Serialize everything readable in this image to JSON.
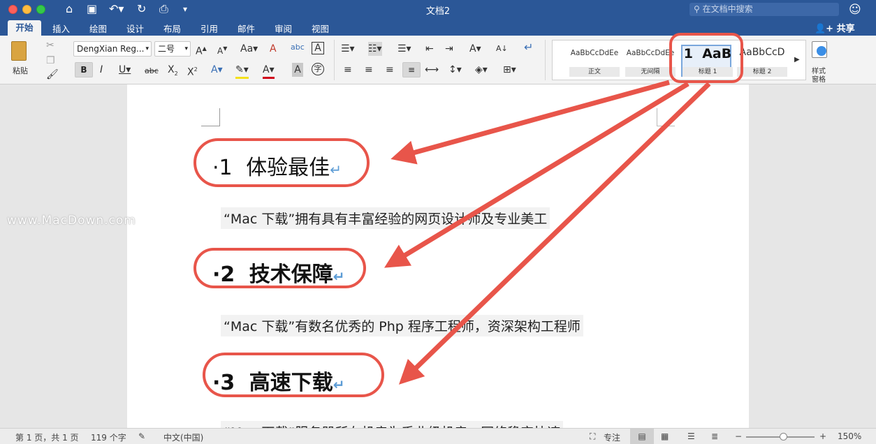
{
  "window": {
    "title": "文档2",
    "search_placeholder": "在文档中搜索",
    "share_label": "共享"
  },
  "tabs": [
    "开始",
    "插入",
    "绘图",
    "设计",
    "布局",
    "引用",
    "邮件",
    "审阅",
    "视图"
  ],
  "ribbon": {
    "paste_label": "粘贴",
    "font_name": "DengXian Reg...",
    "font_size": "二号",
    "styles": [
      {
        "sample": "AaBbCcDdEe",
        "name": "正文"
      },
      {
        "sample": "AaBbCcDdEe",
        "name": "无间隔"
      },
      {
        "sample": "1  AaB",
        "name": "标题 1"
      },
      {
        "sample": "AaBbCcD",
        "name": "标题 2"
      }
    ],
    "styles_pane_label": "样式\n窗格",
    "styles_pane_line1": "样式",
    "styles_pane_line2": "窗格"
  },
  "document": {
    "headings": [
      {
        "number": "1",
        "text": "体验最佳"
      },
      {
        "number": "2",
        "text": "技术保障"
      },
      {
        "number": "3",
        "text": "高速下载"
      }
    ],
    "paragraphs": [
      "“Mac 下载”拥有具有丰富经验的网页设计师及专业美工",
      "“Mac 下载”有数名优秀的 Php 程序工程师，资深架构工程师",
      "“Mac 下载”服务器所在机房为手业级机房，网络稳定快速"
    ],
    "paragraph_mark": "↵"
  },
  "watermark": "www.MacDown.com",
  "statusbar": {
    "page": "第 1 页，共 1 页",
    "words": "119 个字",
    "language": "中文(中国)",
    "focus": "专注",
    "zoom": "150%"
  },
  "colors": {
    "title_bar": "#2b5797",
    "annotation": "#e8554a",
    "paragraph_mark": "#5b9bd5"
  }
}
